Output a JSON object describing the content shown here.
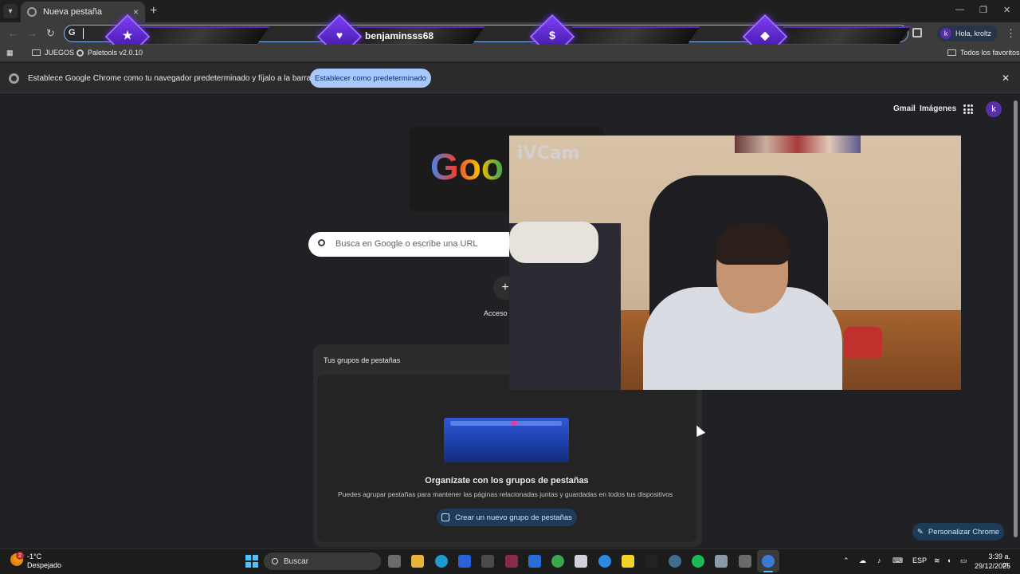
{
  "browser": {
    "tab_title": "Nueva pestaña",
    "tab_close": "×",
    "new_tab": "+",
    "window_controls": [
      "—",
      "❐",
      "✕"
    ],
    "omnibox_icon": "G",
    "profile_initial": "k",
    "profile_label": "Hola, kroltz",
    "menu": "⋮"
  },
  "overlay": {
    "username": "benjaminsss68",
    "icons": [
      "star-icon",
      "heart-icon",
      "dollar-icon",
      "diamond-icon"
    ],
    "glyphs": [
      "★",
      "♥",
      "$",
      "◆"
    ],
    "accent": "#7b3ff2"
  },
  "bookmarks": {
    "items": [
      "JUEGOS",
      "Paletools v2.0.10"
    ],
    "all": "Todos los favoritos"
  },
  "infobar": {
    "text": "Establece Google Chrome como tu navegador predeterminado y fíjalo a la barra de tareas",
    "button": "Establecer como predeterminado",
    "close": "✕"
  },
  "ntp": {
    "gmail": "Gmail",
    "images": "Imágenes",
    "avatar": "k",
    "logo": "Goo",
    "search_placeholder": "Busca en Google o escribe una URL",
    "shortcut_plus": "+",
    "shortcut_label": "Acceso d",
    "tab_groups": {
      "header": "Tus grupos de pestañas",
      "title": "Organízate con los grupos de pestañas",
      "description": "Puedes agrupar pestañas para mantener las páginas relacionadas juntas y guardadas en todos tus dispositivos",
      "button": "Crear un nuevo grupo de pestañas"
    },
    "customize": "Personalizar Chrome",
    "customize_icon": "✎"
  },
  "camera": {
    "label": "iVCam"
  },
  "taskbar": {
    "weather_temp": "-1°C",
    "weather_desc": "Despejado",
    "weather_badge": "2",
    "search": "Buscar",
    "language": "ESP",
    "time": "3:39 a. m.",
    "date": "29/12/2025",
    "apps": [
      "task-view-icon",
      "file-explorer-icon",
      "edge-icon",
      "visual-studio-icon",
      "app-icon",
      "obs-icon",
      "store-icon",
      "xbox-icon",
      "roblox-icon",
      "app-badge-icon",
      "sticky-notes-icon",
      "tiktok-icon",
      "steam-icon",
      "spotify-icon",
      "settings-icon",
      "app2-icon",
      "chrome-icon"
    ],
    "app_colors": [
      "#6b6b6b",
      "#e8b53a",
      "#1f9bd1",
      "#2a62d8",
      "#4a4a4a",
      "#8a2a4a",
      "#2b6fd6",
      "#3aa54a",
      "#cfd3d8",
      "#2c8be0",
      "#f3d22c",
      "#222222",
      "#3d6e8f",
      "#1db954",
      "#8a9aa8",
      "#6a6a6a",
      "#3a7bd5"
    ]
  }
}
